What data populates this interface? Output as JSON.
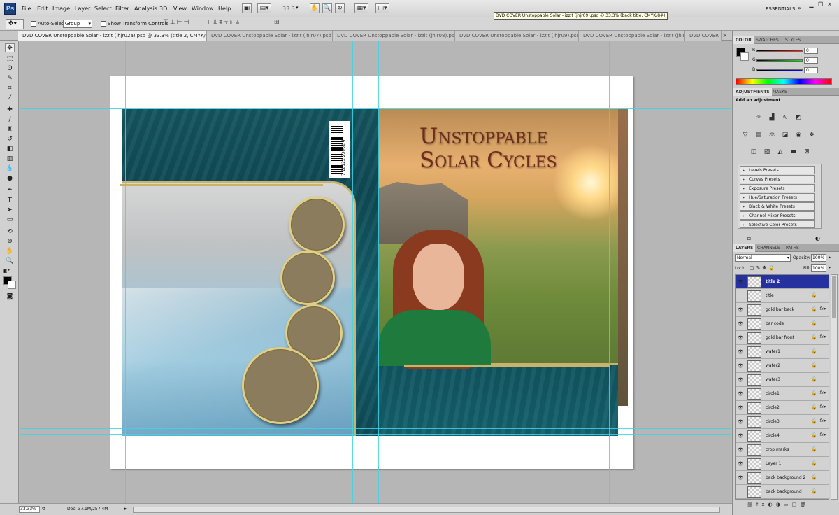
{
  "app": {
    "logo": "Ps",
    "workspace_label": "ESSENTIALS"
  },
  "menu": [
    "File",
    "Edit",
    "Image",
    "Layer",
    "Select",
    "Filter",
    "Analysis",
    "3D",
    "View",
    "Window",
    "Help"
  ],
  "zoom": "33.3",
  "options": {
    "auto_select_label": "Auto-Select:",
    "auto_select_value": "Group",
    "show_transform_label": "Show Transform Controls"
  },
  "tooltip": "DVD COVER Unstoppable Solar - izzit (jhjr09).psd @ 33.3% (back title, CMYK/8#)",
  "tabs": [
    "DVD COVER Unstoppable Solar - izzit (jhjr02a).psd @ 33.3% (title 2, CMYK/8#)",
    "DVD COVER Unstoppable Solar - izzit (jhjr07).psd",
    "DVD COVER Unstoppable Solar - izzit (jhjr08).psd",
    "DVD COVER Unstoppable Solar - izzit (jhjr09).psd",
    "DVD COVER Unstoppable Solar - izzit (jhjr01).psd",
    "DVD COVER Unstoppable Solar - izzit (jhjr10).psd",
    "DVD COVER"
  ],
  "cover": {
    "title_line1": "Unstoppable",
    "title_line2": "Solar Cycles",
    "barcode_number": "7 18122 23062 4"
  },
  "status": {
    "zoom": "33.33%",
    "doc": "Doc: 37.1M/257.4M"
  },
  "color_panel": {
    "tabs": [
      "COLOR",
      "SWATCHES",
      "STYLES"
    ],
    "r_label": "R",
    "g_label": "G",
    "b_label": "B",
    "r": "0",
    "g": "0",
    "b": "0"
  },
  "adjustments_panel": {
    "tabs": [
      "ADJUSTMENTS",
      "MASKS"
    ],
    "heading": "Add an adjustment",
    "presets": [
      "Levels Presets",
      "Curves Presets",
      "Exposure Presets",
      "Hue/Saturation Presets",
      "Black & White Presets",
      "Channel Mixer Presets",
      "Selective Color Presets"
    ]
  },
  "layers_panel": {
    "tabs": [
      "LAYERS",
      "CHANNELS",
      "PATHS"
    ],
    "blend_mode": "Normal",
    "opacity_label": "Opacity:",
    "opacity": "100%",
    "lock_label": "Lock:",
    "fill_label": "Fill:",
    "fill": "100%",
    "layers": [
      {
        "name": "title 2",
        "visible": true,
        "selected": true,
        "fx": false
      },
      {
        "name": "title",
        "visible": false,
        "selected": false,
        "fx": false
      },
      {
        "name": "gold bar back",
        "visible": true,
        "selected": false,
        "fx": true
      },
      {
        "name": "bar code",
        "visible": true,
        "selected": false,
        "fx": false
      },
      {
        "name": "gold bar front",
        "visible": true,
        "selected": false,
        "fx": true
      },
      {
        "name": "water1",
        "visible": true,
        "selected": false,
        "fx": false
      },
      {
        "name": "water2",
        "visible": true,
        "selected": false,
        "fx": false
      },
      {
        "name": "water3",
        "visible": true,
        "selected": false,
        "fx": false
      },
      {
        "name": "circle1",
        "visible": true,
        "selected": false,
        "fx": true
      },
      {
        "name": "circle2",
        "visible": true,
        "selected": false,
        "fx": true
      },
      {
        "name": "circle3",
        "visible": true,
        "selected": false,
        "fx": true
      },
      {
        "name": "circle4",
        "visible": true,
        "selected": false,
        "fx": true
      },
      {
        "name": "crop marks",
        "visible": true,
        "selected": false,
        "fx": false
      },
      {
        "name": "Layer 1",
        "visible": true,
        "selected": false,
        "fx": false
      },
      {
        "name": "back background 2",
        "visible": true,
        "selected": false,
        "fx": false
      },
      {
        "name": "back background",
        "visible": false,
        "selected": false,
        "fx": false
      }
    ]
  }
}
